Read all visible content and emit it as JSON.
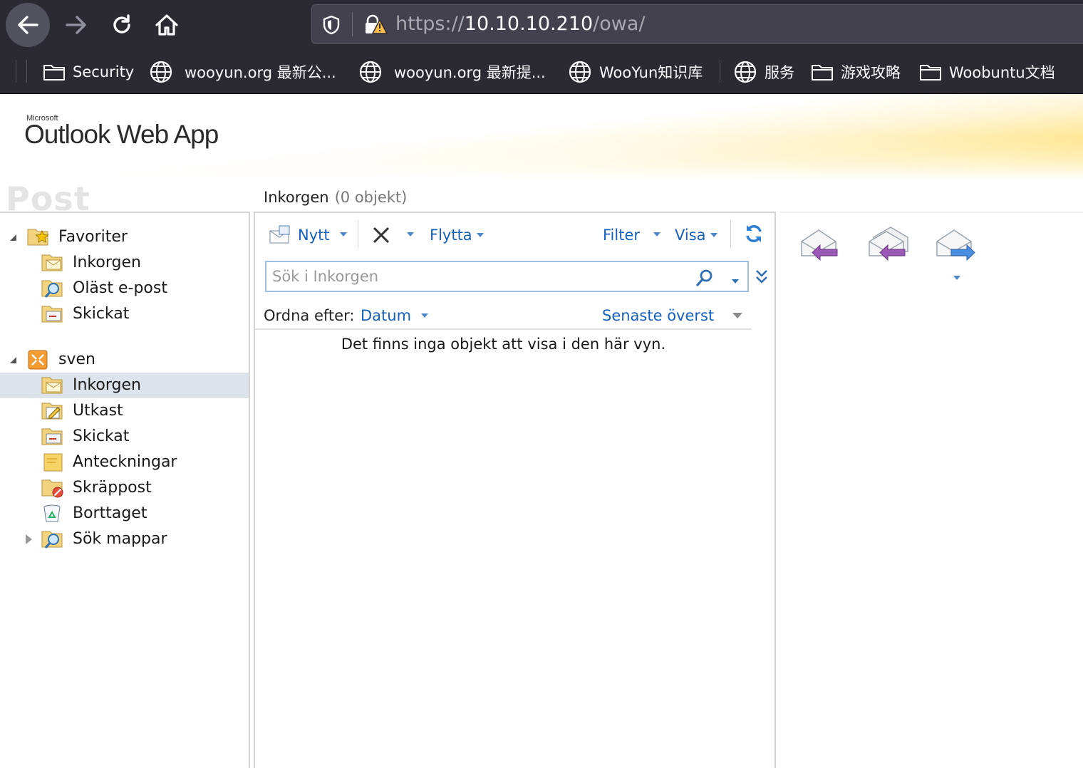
{
  "browser": {
    "url_scheme": "https://",
    "url_host": "10.10.10.210",
    "url_path": "/owa/",
    "bookmarks": [
      {
        "label": "Security",
        "icon": "folder-icon"
      },
      {
        "label": "wooyun.org 最新公...",
        "icon": "globe-icon"
      },
      {
        "label": "wooyun.org 最新提...",
        "icon": "globe-icon"
      },
      {
        "label": "WooYun知识库",
        "icon": "globe-icon"
      },
      {
        "label": "服务",
        "icon": "globe-icon"
      },
      {
        "label": "游戏攻略",
        "icon": "folder-icon"
      },
      {
        "label": "Woobuntu文档",
        "icon": "folder-icon"
      }
    ]
  },
  "header": {
    "microsoft_label": "Microsoft",
    "product_name": "Outlook Web App"
  },
  "nav": {
    "module_title": "Post",
    "favorites": {
      "label": "Favoriter",
      "items": [
        {
          "label": "Inkorgen",
          "icon": "inbox-folder-icon"
        },
        {
          "label": "Oläst e-post",
          "icon": "search-folder-icon"
        },
        {
          "label": "Skickat",
          "icon": "sent-folder-icon"
        }
      ]
    },
    "mailbox": {
      "label": "sven",
      "items": [
        {
          "label": "Inkorgen",
          "icon": "inbox-folder-icon",
          "selected": true
        },
        {
          "label": "Utkast",
          "icon": "drafts-folder-icon"
        },
        {
          "label": "Skickat",
          "icon": "sent-folder-icon"
        },
        {
          "label": "Anteckningar",
          "icon": "notes-folder-icon"
        },
        {
          "label": "Skräppost",
          "icon": "junk-folder-icon"
        },
        {
          "label": "Borttaget",
          "icon": "recycle-bin-icon"
        },
        {
          "label": "Sök mappar",
          "icon": "search-folders-icon"
        }
      ]
    }
  },
  "list": {
    "folder_name": "Inkorgen",
    "item_count": "(0 objekt)",
    "toolbar": {
      "new_label": "Nytt",
      "move_label": "Flytta",
      "filter_label": "Filter",
      "view_label": "Visa"
    },
    "search_placeholder": "Sök i Inkorgen",
    "sort_by_label": "Ordna efter:",
    "sort_field": "Datum",
    "sort_order": "Senaste överst",
    "empty_message": "Det finns inga objekt att visa i den här vyn."
  },
  "colors": {
    "link_blue": "#1560bd",
    "selection": "#dde3ea",
    "browser_chrome": "#2b2a33"
  }
}
